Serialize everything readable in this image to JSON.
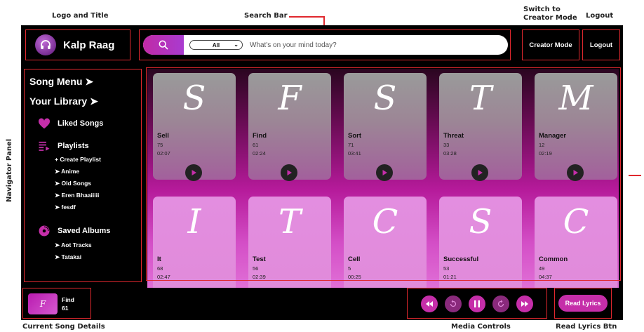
{
  "annotations": {
    "logo_title": "Logo and Title",
    "search_bar": "Search Bar",
    "switch_creator_1": "Switch to",
    "switch_creator_2": "Creator Mode",
    "logout": "Logout",
    "navigator": "Navigator Panel",
    "current_song": "Current Song Details",
    "media_controls": "Media Controls",
    "read_lyrics_btn": "Read Lyrics Btn"
  },
  "header": {
    "app_title": "Kalp Raag",
    "search_filter": "All",
    "search_placeholder": "What's on your mind today?",
    "creator_mode": "Creator Mode",
    "logout": "Logout"
  },
  "sidebar": {
    "song_menu": "Song Menu ➤",
    "your_library": "Your Library ➤",
    "liked_songs": "Liked Songs",
    "playlists": "Playlists",
    "playlist_items": [
      "+ Create Playlist",
      "➤ Anime",
      "➤ Old Songs",
      "➤ Eren Bhaaiiiii",
      "➤ fesdf"
    ],
    "saved_albums": "Saved Albums",
    "album_items": [
      "➤ Aot Tracks",
      "➤ Tatakai"
    ]
  },
  "songs": [
    {
      "glyph": "S",
      "name": "Sell",
      "count": "75",
      "duration": "02:07"
    },
    {
      "glyph": "F",
      "name": "Find",
      "count": "61",
      "duration": "02:24"
    },
    {
      "glyph": "S",
      "name": "Sort",
      "count": "71",
      "duration": "03:41"
    },
    {
      "glyph": "T",
      "name": "Threat",
      "count": "33",
      "duration": "03:28"
    },
    {
      "glyph": "M",
      "name": "Manager",
      "count": "12",
      "duration": "02:19"
    },
    {
      "glyph": "I",
      "name": "It",
      "count": "68",
      "duration": "02:47"
    },
    {
      "glyph": "T",
      "name": "Test",
      "count": "56",
      "duration": "02:39"
    },
    {
      "glyph": "C",
      "name": "Cell",
      "count": "5",
      "duration": "00:25"
    },
    {
      "glyph": "S",
      "name": "Successful",
      "count": "53",
      "duration": "01:21"
    },
    {
      "glyph": "C",
      "name": "Common",
      "count": "49",
      "duration": "04:37"
    }
  ],
  "current_song": {
    "glyph": "F",
    "name": "Find",
    "count": "61"
  },
  "read_lyrics": "Read Lyrics",
  "colors": {
    "accent": "#c52ea9",
    "highlight": "#e0282e"
  }
}
